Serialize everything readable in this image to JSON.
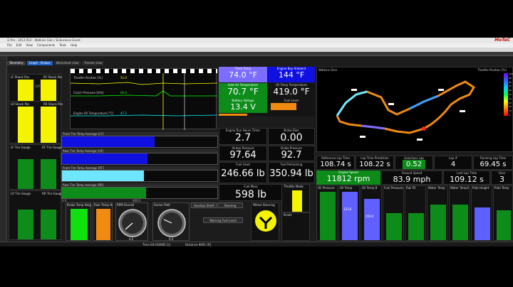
{
  "window": {
    "title": "i2 Pro - 2013 R12 - Watkins Glen / Endurance Event",
    "brand": "MoTeC",
    "menus": [
      "File",
      "Edit",
      "View",
      "Components",
      "Tools",
      "Help"
    ]
  },
  "tabs": [
    "Telemetry",
    "Graph - Brakes",
    "Worksheet view",
    "Tracker view"
  ],
  "left": {
    "panels": [
      {
        "label": "LF Shock Pos",
        "label2": "RF Shock Pos",
        "v1": "0",
        "v2": "147",
        "v3": "0.0"
      },
      {
        "label": "LR Shock Pos",
        "label2": "RR Shock Pos",
        "v1": "0",
        "v2": "147",
        "v3": "0.0"
      },
      {
        "label": "LF Tire Gauge",
        "label2": "RF Tire Gauge",
        "v1": "25",
        "v2": "0"
      },
      {
        "label": "LR Tire Gauge",
        "label2": "RR Tire Gauge",
        "v1": "25",
        "v2": "0"
      }
    ]
  },
  "graph": {
    "rows": [
      "Throttle Position [%]",
      "Clutch Pressure [kPa]",
      "Engine Oil Temperature [°C]"
    ],
    "values": [
      "52.0",
      "60.0",
      "47.2"
    ]
  },
  "tire_temps": {
    "rows": [
      "Front Tire Temp Average [LF]",
      "Rear Tire Temp Average [LR]",
      "Front Tire Temp Average [RF]",
      "Rear Tire Temp Average [RR]"
    ],
    "min": "0.0",
    "max": "400.0"
  },
  "center_tiles": {
    "track_temp": {
      "label": "Track Temp",
      "value": "74.0 °F"
    },
    "engine_bay": {
      "label": "Engine Bay Ambient",
      "value": "144 °F"
    },
    "inlet_air": {
      "label": "Inlet Air Temperature",
      "value": "70.7 °F"
    },
    "oil_temp": {
      "label": "Oil Temp Temperature",
      "value": "419.0 °F"
    },
    "battery": {
      "label": "Battery Voltage",
      "value": "13.4 V"
    },
    "fuel": {
      "label": "Fuel Level",
      "value": ""
    },
    "engine_run_hours": {
      "label": "Engine Run Hours Timer",
      "value": "2.7"
    },
    "brake_bias": {
      "label": "Brake Bias",
      "value": "0.00"
    },
    "airbox_pressure": {
      "label": "Airbox Pressure",
      "value": "97.64"
    },
    "brake_pressure": {
      "label": "Brake Pressure",
      "value": "92.7"
    },
    "fuel_used": {
      "label": "Fuel Used",
      "value": "246.66 lb"
    },
    "fuel_remaining": {
      "label": "Fuel Remaining",
      "value": "350.94 lb"
    },
    "fuel_mass": {
      "label": "Fuel Mass",
      "value": "598 lb"
    }
  },
  "map": {
    "title": "Watkins Glen",
    "legend_title": "Throttle Position [%]",
    "legend_values": [
      "100",
      "90",
      "80",
      "70",
      "60",
      "50",
      "40",
      "30",
      "20",
      "10",
      "0"
    ]
  },
  "laps": {
    "reference_lap": {
      "label": "Reference Lap Time",
      "value": "108.74 s"
    },
    "lap_prediction": {
      "label": "Lap Time Prediction",
      "value": "108.22 s"
    },
    "gain_loss": {
      "label": "Gain/Loss Lap",
      "value": "0.52"
    },
    "lap_number": {
      "label": "Lap #",
      "value": "4"
    },
    "running_lap": {
      "label": "Running Lap Time",
      "value": "69.45 s"
    },
    "engine_speed": {
      "label": "Engine Speed",
      "value": "11812 rpm"
    },
    "ground_speed": {
      "label": "Ground Speed",
      "value": "83.9 mph"
    },
    "last_lap": {
      "label": "Last Lap Time",
      "value": "109.12 s"
    },
    "gear": {
      "label": "Gear",
      "value": "3"
    }
  },
  "bottom": {
    "gauges": [
      "Brake Temp Height",
      "Rear Temp Height",
      "RPM Overall",
      "Sector Path"
    ],
    "dial1_value": "0.0",
    "dial2_value": "0.0",
    "buttons": [
      "Gearbox Shaft",
      "Steering",
      "Warning Fuel Level",
      "Throttle Mode",
      "Brake"
    ],
    "wheel_label": "Wheel Steering"
  },
  "right_bottom": {
    "labels": [
      "Oil Pressure",
      "Oil Temp",
      "Oil Temp B",
      "Fuel Pressure",
      "Rail P2",
      "Water Temp",
      "Water Temp2",
      "Ride Height",
      "Ride Temp"
    ],
    "values": [
      "20",
      "333.6",
      "250.0",
      "30",
      "20",
      "80",
      "80",
      "5",
      "5"
    ]
  },
  "status": {
    "time": "Time 69.030985 [s]",
    "distance": "Distance 9661 [ft]"
  },
  "colors": {
    "yellow": "#f4f400",
    "green": "#0d8c1a",
    "blue": "#1010e0",
    "lightblue": "#6ee6ff",
    "orange": "#f08a10",
    "violet": "#7c6cff"
  }
}
